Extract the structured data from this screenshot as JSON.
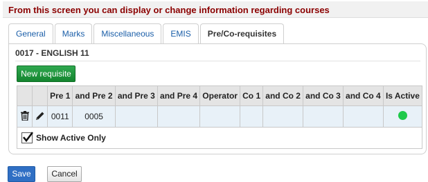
{
  "instructions": "From this screen you can display or change information regarding courses",
  "tabs": [
    {
      "label": "General"
    },
    {
      "label": "Marks"
    },
    {
      "label": "Miscellaneous"
    },
    {
      "label": "EMIS"
    },
    {
      "label": "Pre/Co-requisites",
      "active": true
    }
  ],
  "course": {
    "title": "0017 - ENGLISH 11"
  },
  "new_button": "New requisite",
  "table": {
    "headers": [
      "Pre 1",
      "and Pre 2",
      "and Pre 3",
      "and Pre 4",
      "Operator",
      "Co 1",
      "and Co 2",
      "and Co 3",
      "and Co 4",
      "Is Active"
    ],
    "rows": [
      {
        "pre1": "0011",
        "pre2": "0005",
        "pre3": "",
        "pre4": "",
        "operator": "",
        "co1": "",
        "co2": "",
        "co3": "",
        "co4": "",
        "is_active": true
      }
    ],
    "row_icons": [
      "trash-icon",
      "pencil-icon"
    ],
    "active_color": "#1ec94a",
    "header_bg": "#e4e4e4",
    "row_bg": "#e8f1f8"
  },
  "show_active_only": {
    "label": "Show Active Only",
    "checked": true
  },
  "buttons": {
    "save": "Save",
    "cancel": "Cancel"
  },
  "colors": {
    "instructions_text": "#8b0000",
    "tab_link": "#1a5ea8",
    "new_button": "#1f9a3f",
    "save_button": "#2f6fc4"
  }
}
